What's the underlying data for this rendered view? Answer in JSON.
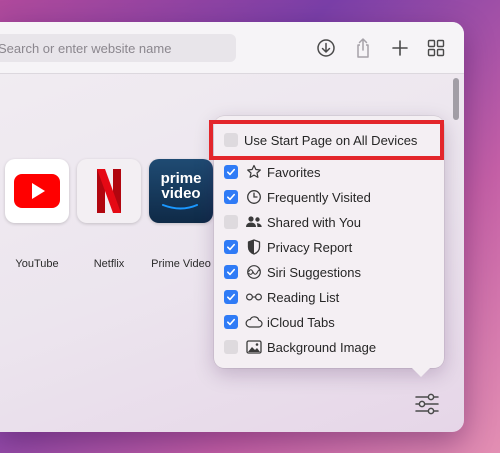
{
  "search": {
    "placeholder": "Search or enter website name"
  },
  "favorites": [
    {
      "label": "YouTube"
    },
    {
      "label": "Netflix"
    },
    {
      "label": "Prime Video",
      "logo_text": "prime video"
    }
  ],
  "start_page_option": {
    "label": "Use Start Page on All Devices",
    "checked": false
  },
  "menu_items": [
    {
      "label": "Favorites",
      "checked": true,
      "icon": "star-icon"
    },
    {
      "label": "Frequently Visited",
      "checked": true,
      "icon": "clock-icon"
    },
    {
      "label": "Shared with You",
      "checked": false,
      "icon": "people-icon"
    },
    {
      "label": "Privacy Report",
      "checked": true,
      "icon": "shield-icon"
    },
    {
      "label": "Siri Suggestions",
      "checked": true,
      "icon": "siri-icon"
    },
    {
      "label": "Reading List",
      "checked": true,
      "icon": "glasses-icon"
    },
    {
      "label": "iCloud Tabs",
      "checked": true,
      "icon": "cloud-icon"
    },
    {
      "label": "Background Image",
      "checked": false,
      "icon": "image-icon"
    }
  ],
  "colors": {
    "checkbox_on": "#2f7bf6",
    "highlight": "#e3262b",
    "youtube_red": "#ff0000",
    "netflix_red": "#e50914",
    "prime_blue": "#1a98ff"
  }
}
